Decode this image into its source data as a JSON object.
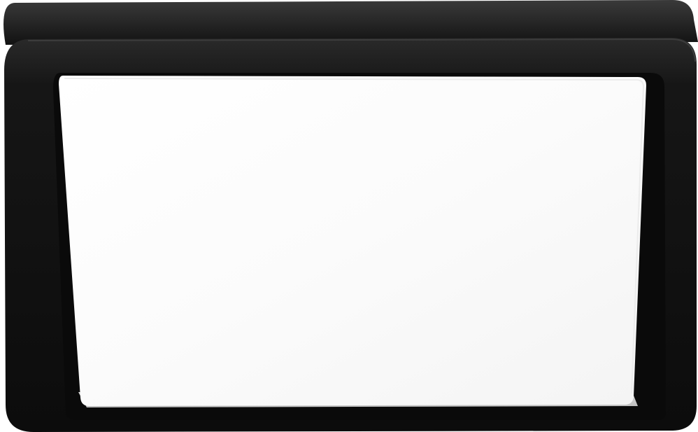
{
  "image": {
    "subject": "square-led-panel-light",
    "colors": {
      "background": "#ffffff",
      "frame": "#141414",
      "frame_highlight": "#2b2b2b",
      "frame_shadow": "#050505",
      "diffuser": "#fafafa",
      "diffuser_edge": "#e6e6e6"
    }
  }
}
